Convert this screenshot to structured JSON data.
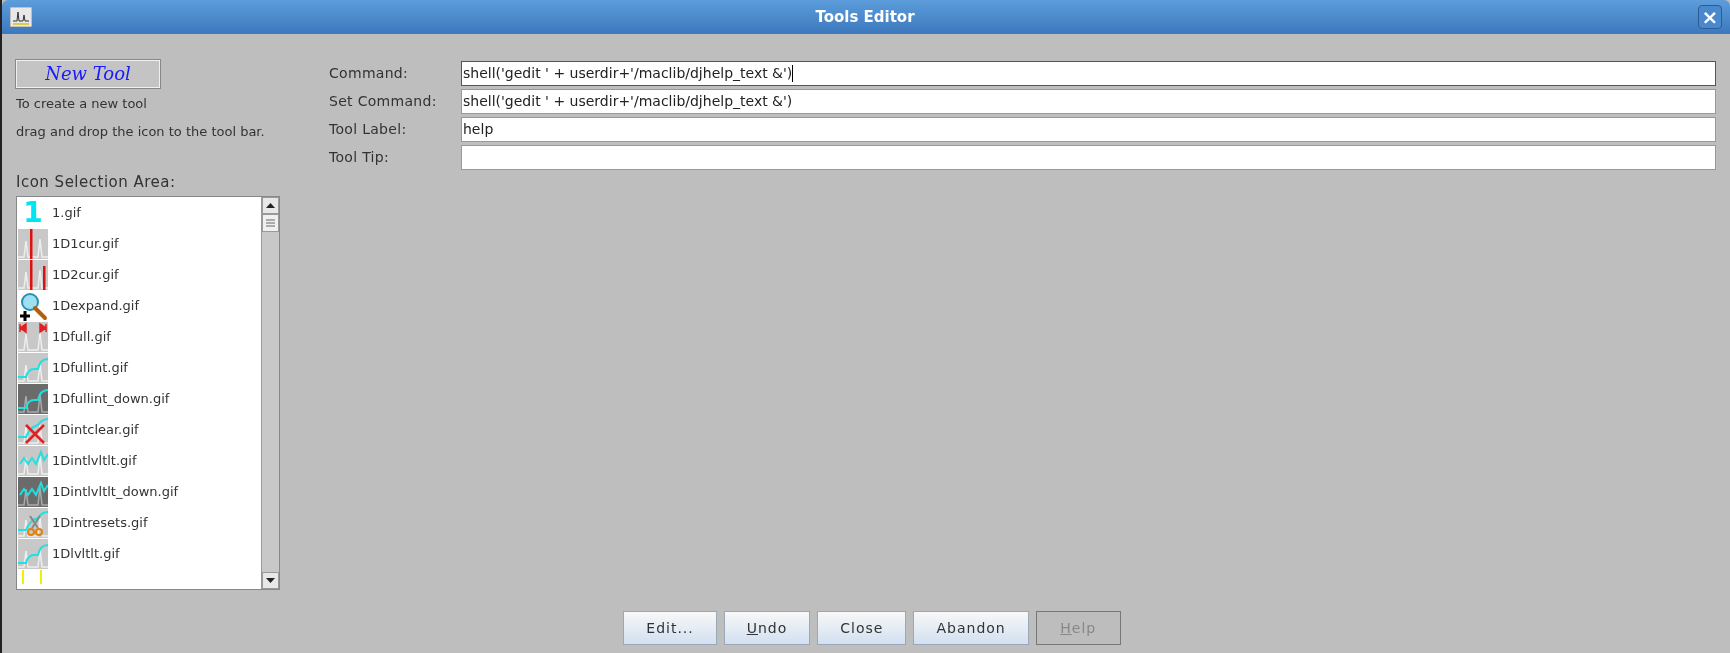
{
  "window": {
    "title": "Tools Editor",
    "close_glyph": "×"
  },
  "new_tool_button": "New Tool",
  "instructions": [
    "To create a new tool",
    "drag and drop the icon to the tool bar."
  ],
  "icon_area_label": "Icon Selection Area:",
  "icons": [
    {
      "name": "1.gif",
      "kind": "digit",
      "icon_text": "1"
    },
    {
      "name": "1D1cur.gif",
      "kind": "cursor-one"
    },
    {
      "name": "1D2cur.gif",
      "kind": "cursor-two"
    },
    {
      "name": "1Dexpand.gif",
      "kind": "magnifier"
    },
    {
      "name": "1Dfull.gif",
      "kind": "full"
    },
    {
      "name": "1Dfullint.gif",
      "kind": "integral"
    },
    {
      "name": "1Dfullint_down.gif",
      "kind": "integral-down"
    },
    {
      "name": "1Dintclear.gif",
      "kind": "clear"
    },
    {
      "name": "1Dintlvltlt.gif",
      "kind": "levels"
    },
    {
      "name": "1Dintlvltlt_down.gif",
      "kind": "levels-down"
    },
    {
      "name": "1Dintresets.gif",
      "kind": "scissors"
    },
    {
      "name": "1Dlvltlt.gif",
      "kind": "integral"
    },
    {
      "kind": "mark"
    }
  ],
  "fields": [
    {
      "label": "Command:",
      "value": "shell('gedit ' + userdir+'/maclib/djhelp_text &')",
      "focused": true
    },
    {
      "label": "Set Command:",
      "value": "shell('gedit ' + userdir+'/maclib/djhelp_text &')",
      "focused": false
    },
    {
      "label": "Tool Label:",
      "value": "help",
      "focused": false
    },
    {
      "label": "Tool Tip:",
      "focused": false
    }
  ],
  "buttons": [
    {
      "label": "Edit...",
      "disabled": false
    },
    {
      "mnemonic": "U",
      "rest": "ndo",
      "disabled": false
    },
    {
      "label": "Close",
      "disabled": false
    },
    {
      "label": "Abandon",
      "disabled": false
    },
    {
      "mnemonic": "H",
      "rest": "elp",
      "disabled": true
    }
  ]
}
